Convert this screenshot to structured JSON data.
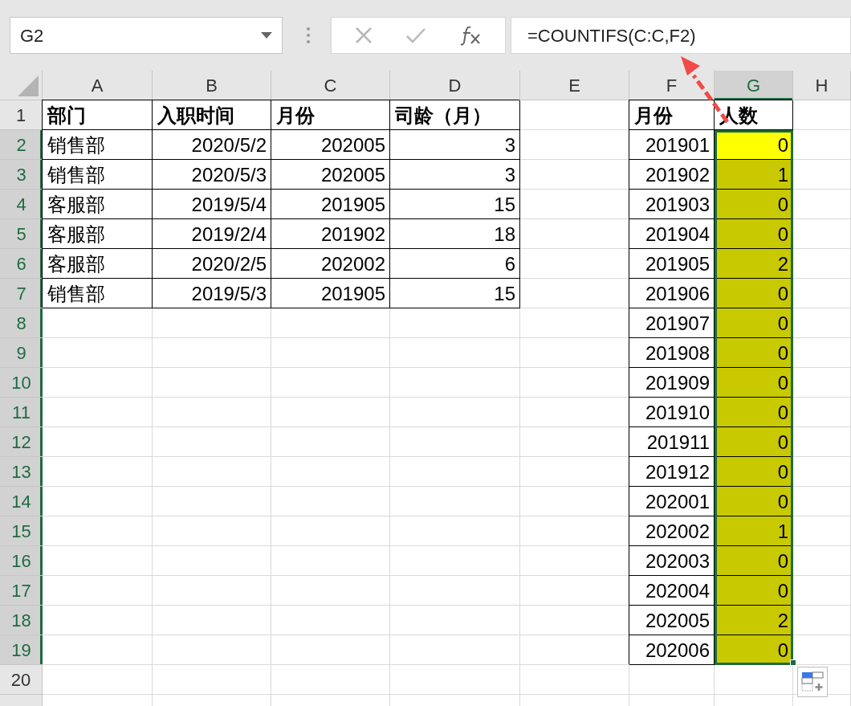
{
  "name_box": {
    "value": "G2"
  },
  "formula_bar": {
    "value": "=COUNTIFS(C:C,F2)"
  },
  "columns": [
    {
      "label": "A",
      "kind": "text",
      "selected": false
    },
    {
      "label": "B",
      "kind": "number",
      "selected": false
    },
    {
      "label": "C",
      "kind": "number",
      "selected": false
    },
    {
      "label": "D",
      "kind": "number",
      "selected": false
    },
    {
      "label": "E",
      "kind": "number",
      "selected": false
    },
    {
      "label": "F",
      "kind": "number",
      "selected": false
    },
    {
      "label": "G",
      "kind": "number",
      "selected": true
    },
    {
      "label": "H",
      "kind": "number",
      "selected": false
    }
  ],
  "rows": [
    {
      "number": "1",
      "kind": "header",
      "selected": false,
      "active": false,
      "cells": {
        "A": "部门",
        "B": "入职时间",
        "C": "月份",
        "D": "司龄（月）",
        "F": "月份",
        "G": "人数"
      }
    },
    {
      "number": "2",
      "kind": "data",
      "selected": true,
      "active": true,
      "cells": {
        "A": "销售部",
        "B": "2020/5/2",
        "C": "202005",
        "D": "3",
        "F": "201901",
        "G": "0"
      }
    },
    {
      "number": "3",
      "kind": "data",
      "selected": true,
      "active": false,
      "cells": {
        "A": "销售部",
        "B": "2020/5/3",
        "C": "202005",
        "D": "3",
        "F": "201902",
        "G": "1"
      }
    },
    {
      "number": "4",
      "kind": "data",
      "selected": true,
      "active": false,
      "cells": {
        "A": "客服部",
        "B": "2019/5/4",
        "C": "201905",
        "D": "15",
        "F": "201903",
        "G": "0"
      }
    },
    {
      "number": "5",
      "kind": "data",
      "selected": true,
      "active": false,
      "cells": {
        "A": "客服部",
        "B": "2019/2/4",
        "C": "201902",
        "D": "18",
        "F": "201904",
        "G": "0"
      }
    },
    {
      "number": "6",
      "kind": "data",
      "selected": true,
      "active": false,
      "cells": {
        "A": "客服部",
        "B": "2020/2/5",
        "C": "202002",
        "D": "6",
        "F": "201905",
        "G": "2"
      }
    },
    {
      "number": "7",
      "kind": "data",
      "selected": true,
      "active": false,
      "cells": {
        "A": "销售部",
        "B": "2019/5/3",
        "C": "201905",
        "D": "15",
        "F": "201906",
        "G": "0"
      }
    },
    {
      "number": "8",
      "kind": "data",
      "selected": true,
      "active": false,
      "cells": {
        "F": "201907",
        "G": "0"
      }
    },
    {
      "number": "9",
      "kind": "data",
      "selected": true,
      "active": false,
      "cells": {
        "F": "201908",
        "G": "0"
      }
    },
    {
      "number": "10",
      "kind": "data",
      "selected": true,
      "active": false,
      "cells": {
        "F": "201909",
        "G": "0"
      }
    },
    {
      "number": "11",
      "kind": "data",
      "selected": true,
      "active": false,
      "cells": {
        "F": "201910",
        "G": "0"
      }
    },
    {
      "number": "12",
      "kind": "data",
      "selected": true,
      "active": false,
      "cells": {
        "F": "201911",
        "G": "0"
      }
    },
    {
      "number": "13",
      "kind": "data",
      "selected": true,
      "active": false,
      "cells": {
        "F": "201912",
        "G": "0"
      }
    },
    {
      "number": "14",
      "kind": "data",
      "selected": true,
      "active": false,
      "cells": {
        "F": "202001",
        "G": "0"
      }
    },
    {
      "number": "15",
      "kind": "data",
      "selected": true,
      "active": false,
      "cells": {
        "F": "202002",
        "G": "1"
      }
    },
    {
      "number": "16",
      "kind": "data",
      "selected": true,
      "active": false,
      "cells": {
        "F": "202003",
        "G": "0"
      }
    },
    {
      "number": "17",
      "kind": "data",
      "selected": true,
      "active": false,
      "cells": {
        "F": "202004",
        "G": "0"
      }
    },
    {
      "number": "18",
      "kind": "data",
      "selected": true,
      "active": false,
      "cells": {
        "F": "202005",
        "G": "2"
      }
    },
    {
      "number": "19",
      "kind": "data",
      "selected": true,
      "active": false,
      "cells": {
        "F": "202006",
        "G": "0"
      }
    },
    {
      "number": "20",
      "kind": "data",
      "selected": false,
      "active": false,
      "cells": {}
    }
  ]
}
